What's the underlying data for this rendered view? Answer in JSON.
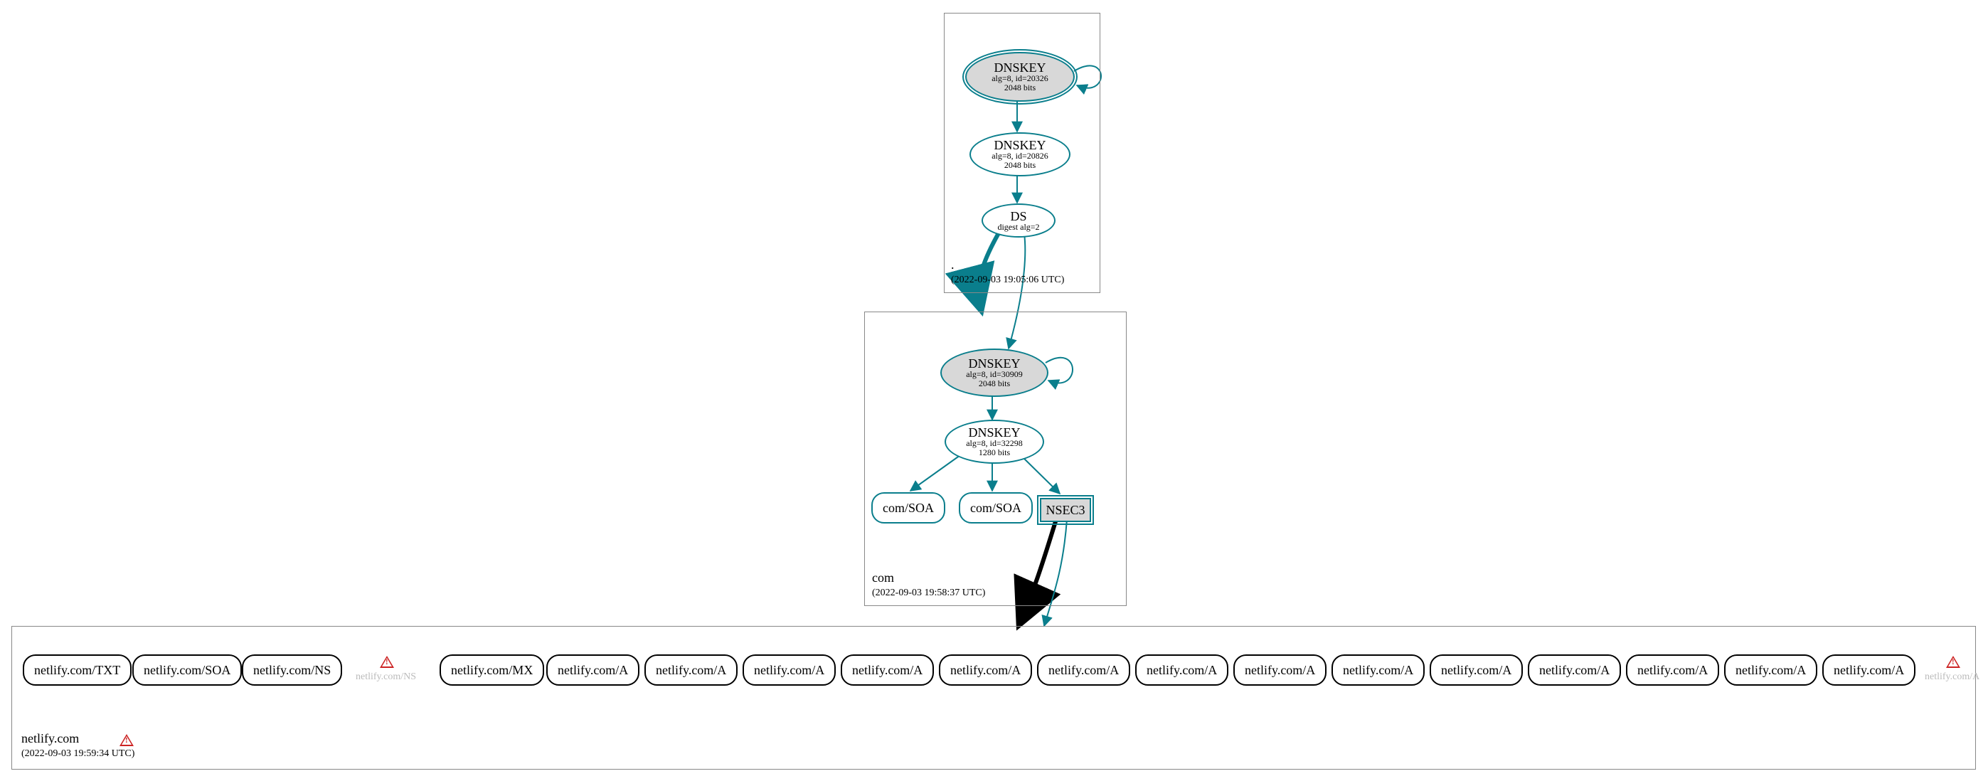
{
  "zones": {
    "root": {
      "label": ".",
      "timestamp": "(2022-09-03 19:05:06 UTC)",
      "nodes": {
        "dnskey1": {
          "title": "DNSKEY",
          "line1": "alg=8, id=20326",
          "line2": "2048 bits"
        },
        "dnskey2": {
          "title": "DNSKEY",
          "line1": "alg=8, id=20826",
          "line2": "2048 bits"
        },
        "ds": {
          "title": "DS",
          "line1": "digest alg=2"
        }
      }
    },
    "com": {
      "label": "com",
      "timestamp": "(2022-09-03 19:58:37 UTC)",
      "nodes": {
        "dnskey1": {
          "title": "DNSKEY",
          "line1": "alg=8, id=30909",
          "line2": "2048 bits"
        },
        "dnskey2": {
          "title": "DNSKEY",
          "line1": "alg=8, id=32298",
          "line2": "1280 bits"
        },
        "soa1": {
          "label": "com/SOA"
        },
        "soa2": {
          "label": "com/SOA"
        },
        "nsec3": {
          "label": "NSEC3"
        }
      }
    },
    "netlify": {
      "label": "netlify.com",
      "timestamp": "(2022-09-03 19:59:34 UTC)",
      "warn_ns": "netlify.com/NS",
      "warn_a": "netlify.com/A",
      "records": [
        "netlify.com/TXT",
        "netlify.com/SOA",
        "netlify.com/NS",
        "netlify.com/MX",
        "netlify.com/A",
        "netlify.com/A",
        "netlify.com/A",
        "netlify.com/A",
        "netlify.com/A",
        "netlify.com/A",
        "netlify.com/A",
        "netlify.com/A",
        "netlify.com/A",
        "netlify.com/A",
        "netlify.com/A",
        "netlify.com/A",
        "netlify.com/A",
        "netlify.com/A"
      ]
    }
  }
}
